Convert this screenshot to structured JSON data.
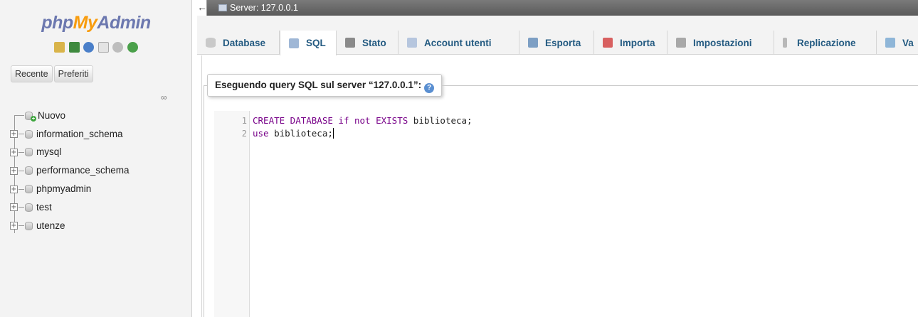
{
  "brand": {
    "part1": "php",
    "part2": "My",
    "part3": "Admin"
  },
  "quick_icons": [
    "home-icon",
    "exit-icon",
    "help-icon",
    "docs-icon",
    "settings-icon",
    "reload-icon"
  ],
  "nav_tabs": [
    "Recente",
    "Preferiti"
  ],
  "tree": {
    "new_label": "Nuovo",
    "databases": [
      "information_schema",
      "mysql",
      "performance_schema",
      "phpmyadmin",
      "test",
      "utenze"
    ]
  },
  "serverbar": {
    "label": "Server: 127.0.0.1",
    "collapse_symbol": "←"
  },
  "menu": [
    {
      "label": "Database",
      "icon": "database-icon",
      "color": "#c9c9c9"
    },
    {
      "label": "SQL",
      "icon": "sql-icon",
      "color": "#9fb7d6"
    },
    {
      "label": "Stato",
      "icon": "status-icon",
      "color": "#8a8a8a"
    },
    {
      "label": "Account utenti",
      "icon": "users-icon",
      "color": "#b6c6de"
    },
    {
      "label": "Esporta",
      "icon": "export-icon",
      "color": "#7d9fc4"
    },
    {
      "label": "Importa",
      "icon": "import-icon",
      "color": "#d86060"
    },
    {
      "label": "Impostazioni",
      "icon": "wrench-icon",
      "color": "#a8a8a8"
    },
    {
      "label": "Replicazione",
      "icon": "replication-icon",
      "color": "#b8b8b8"
    },
    {
      "label": "Va",
      "icon": "variables-icon",
      "color": "#8fb6d8"
    }
  ],
  "active_tab": "SQL",
  "query_panel": {
    "legend": "Eseguendo query SQL sul server “127.0.0.1”:",
    "help": "?"
  },
  "code": [
    {
      "line": "1",
      "parts": [
        {
          "t": "CREATE DATABASE ",
          "c": "kw"
        },
        {
          "t": "if not EXISTS",
          "c": "kw"
        },
        {
          "t": " biblioteca;",
          "c": "txt"
        }
      ]
    },
    {
      "line": "2",
      "parts": [
        {
          "t": "use",
          "c": "kw"
        },
        {
          "t": " biblioteca;",
          "c": "txt"
        }
      ]
    }
  ],
  "colors": {
    "link": "#235a81",
    "keyword": "#770088",
    "logo_blue": "#6c78af",
    "logo_orange": "#f89c0e"
  }
}
